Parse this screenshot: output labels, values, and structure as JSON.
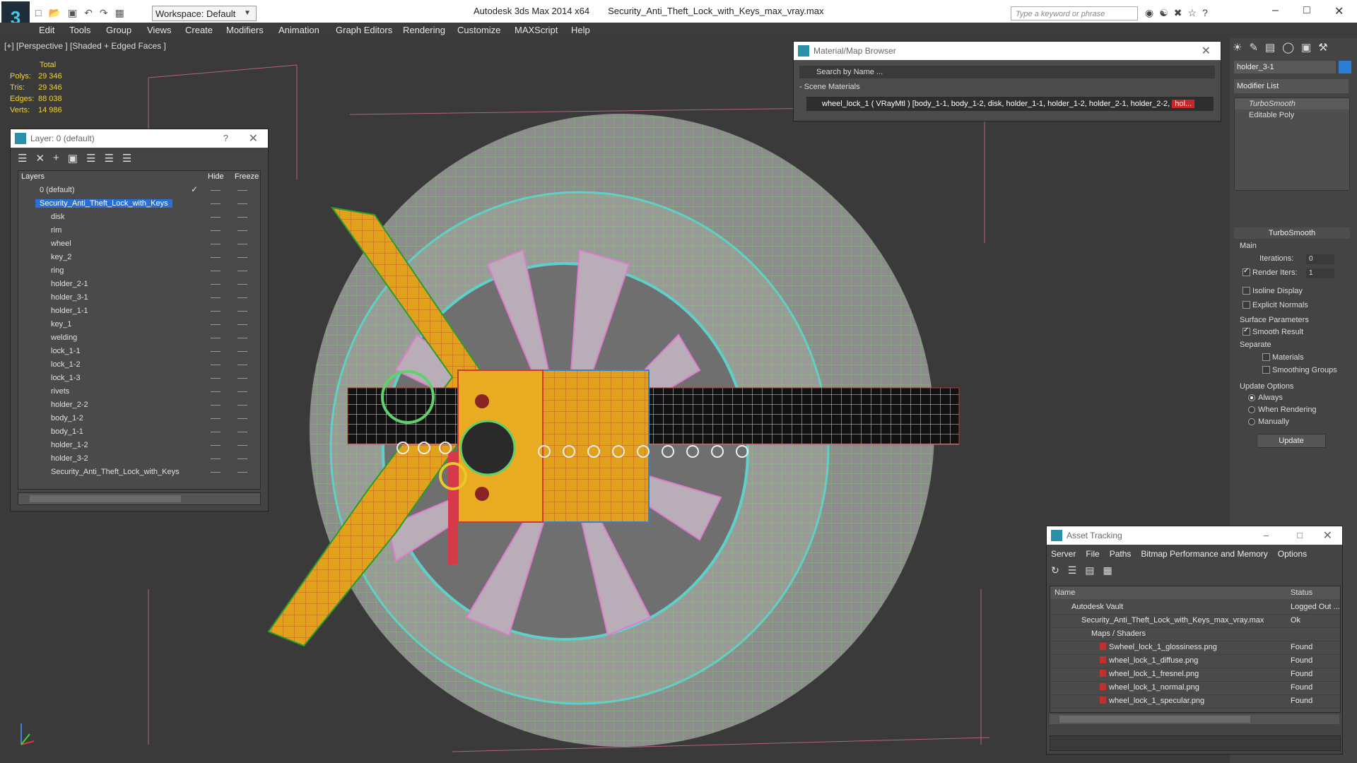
{
  "title_bar": {
    "app": "Autodesk 3ds Max  2014 x64",
    "file": "Security_Anti_Theft_Lock_with_Keys_max_vray.max",
    "workspace": "Workspace: Default",
    "search_placeholder": "Type a keyword or phrase"
  },
  "menu": [
    "Edit",
    "Tools",
    "Group",
    "Views",
    "Create",
    "Modifiers",
    "Animation",
    "Graph Editors",
    "Rendering",
    "Customize",
    "MAXScript",
    "Help"
  ],
  "viewport": {
    "label": "[+] [Perspective ] [Shaded + Edged Faces ]",
    "stats": {
      "header": "Total",
      "polys_label": "Polys:",
      "polys": "29 346",
      "tris_label": "Tris:",
      "tris": "29 346",
      "edges_label": "Edges:",
      "edges": "88 038",
      "verts_label": "Verts:",
      "verts": "14 986"
    }
  },
  "layer_panel": {
    "title": "Layer: 0 (default)",
    "col_layers": "Layers",
    "col_hide": "Hide",
    "col_freeze": "Freeze",
    "layers": [
      "0 (default)",
      "Security_Anti_Theft_Lock_with_Keys",
      "disk",
      "rim",
      "wheel",
      "key_2",
      "ring",
      "holder_2-1",
      "holder_3-1",
      "holder_1-1",
      "key_1",
      "welding",
      "lock_1-1",
      "lock_1-2",
      "lock_1-3",
      "rivets",
      "holder_2-2",
      "body_1-2",
      "body_1-1",
      "holder_1-2",
      "holder_3-2",
      "Security_Anti_Theft_Lock_with_Keys"
    ]
  },
  "material_browser": {
    "title": "Material/Map Browser",
    "search": "Search by Name ...",
    "section": "- Scene Materials",
    "item_text": "wheel_lock_1  ( VRayMtl )  [body_1-1, body_1-2, disk, holder_1-1, holder_1-2, holder_2-1, holder_2-2, ",
    "item_highlight": "hol..."
  },
  "command_panel": {
    "object_name": "holder_3-1",
    "modifier_list": "Modifier List",
    "stack": [
      "TurboSmooth",
      "Editable Poly"
    ],
    "rollout": "TurboSmooth",
    "main": "Main",
    "iterations_label": "Iterations:",
    "iterations": "0",
    "render_iters_label": "Render Iters:",
    "render_iters": "1",
    "isoline": "Isoline Display",
    "explicit": "Explicit Normals",
    "surface": "Surface Parameters",
    "smooth": "Smooth Result",
    "separate": "Separate",
    "materials": "Materials",
    "smoothing": "Smoothing Groups",
    "update_options": "Update Options",
    "always": "Always",
    "when_rendering": "When Rendering",
    "manually": "Manually",
    "update_btn": "Update"
  },
  "asset_tracking": {
    "title": "Asset Tracking",
    "menu": [
      "Server",
      "File",
      "Paths",
      "Bitmap Performance and Memory",
      "Options"
    ],
    "col_name": "Name",
    "col_status": "Status",
    "rows": [
      {
        "name": "Autodesk Vault",
        "status": "Logged Out ..."
      },
      {
        "name": "Security_Anti_Theft_Lock_with_Keys_max_vray.max",
        "status": "Ok"
      },
      {
        "name": "Maps / Shaders",
        "status": ""
      },
      {
        "name": "Swheel_lock_1_glossiness.png",
        "status": "Found"
      },
      {
        "name": "wheel_lock_1_diffuse.png",
        "status": "Found"
      },
      {
        "name": "wheel_lock_1_fresnel.png",
        "status": "Found"
      },
      {
        "name": "wheel_lock_1_normal.png",
        "status": "Found"
      },
      {
        "name": "wheel_lock_1_specular.png",
        "status": "Found"
      }
    ]
  }
}
